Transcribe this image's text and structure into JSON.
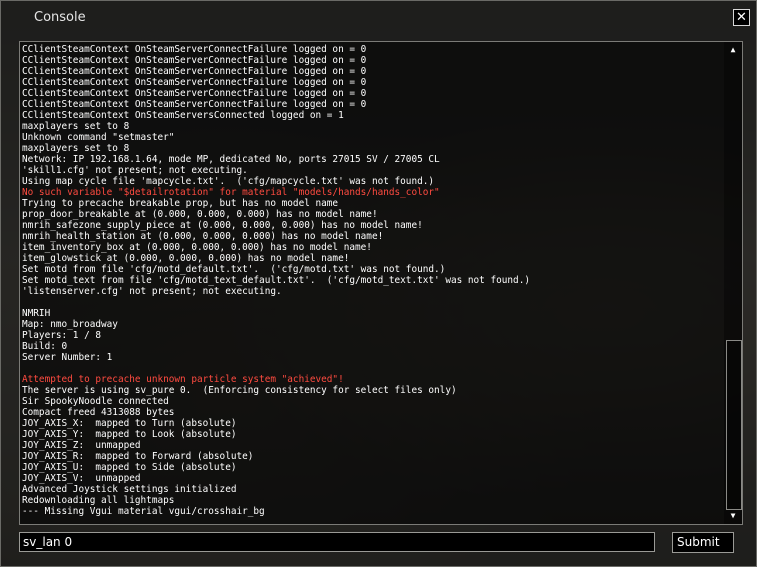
{
  "window": {
    "title": "Console",
    "close_icon": "close-icon"
  },
  "console": {
    "lines": [
      {
        "text": "CClientSteamContext OnSteamServerConnectFailure logged on = 0",
        "color": "#ffffff"
      },
      {
        "text": "CClientSteamContext OnSteamServerConnectFailure logged on = 0",
        "color": "#ffffff"
      },
      {
        "text": "CClientSteamContext OnSteamServerConnectFailure logged on = 0",
        "color": "#ffffff"
      },
      {
        "text": "CClientSteamContext OnSteamServerConnectFailure logged on = 0",
        "color": "#ffffff"
      },
      {
        "text": "CClientSteamContext OnSteamServerConnectFailure logged on = 0",
        "color": "#ffffff"
      },
      {
        "text": "CClientSteamContext OnSteamServerConnectFailure logged on = 0",
        "color": "#ffffff"
      },
      {
        "text": "CClientSteamContext OnSteamServersConnected logged on = 1",
        "color": "#ffffff"
      },
      {
        "text": "maxplayers set to 8",
        "color": "#ffffff"
      },
      {
        "text": "Unknown command \"setmaster\"",
        "color": "#ffffff"
      },
      {
        "text": "maxplayers set to 8",
        "color": "#ffffff"
      },
      {
        "text": "Network: IP 192.168.1.64, mode MP, dedicated No, ports 27015 SV / 27005 CL",
        "color": "#ffffff"
      },
      {
        "text": "'skill1.cfg' not present; not executing.",
        "color": "#ffffff"
      },
      {
        "text": "Using map cycle file 'mapcycle.txt'.  ('cfg/mapcycle.txt' was not found.)",
        "color": "#ffffff"
      },
      {
        "text": "No such variable \"$detailrotation\" for material \"models/hands/hands_color\"",
        "color": "#ff4b40"
      },
      {
        "text": "Trying to precache breakable prop, but has no model name",
        "color": "#ffffff"
      },
      {
        "text": "prop_door_breakable at (0.000, 0.000, 0.000) has no model name!",
        "color": "#ffffff"
      },
      {
        "text": "nmrih_safezone_supply_piece at (0.000, 0.000, 0.000) has no model name!",
        "color": "#ffffff"
      },
      {
        "text": "nmrih_health_station at (0.000, 0.000, 0.000) has no model name!",
        "color": "#ffffff"
      },
      {
        "text": "item_inventory_box at (0.000, 0.000, 0.000) has no model name!",
        "color": "#ffffff"
      },
      {
        "text": "item_glowstick at (0.000, 0.000, 0.000) has no model name!",
        "color": "#ffffff"
      },
      {
        "text": "Set motd from file 'cfg/motd_default.txt'.  ('cfg/motd.txt' was not found.)",
        "color": "#ffffff"
      },
      {
        "text": "Set motd_text from file 'cfg/motd_text_default.txt'.  ('cfg/motd_text.txt' was not found.)",
        "color": "#ffffff"
      },
      {
        "text": "'listenserver.cfg' not present; not executing.",
        "color": "#ffffff"
      },
      {
        "text": "",
        "color": "#ffffff"
      },
      {
        "text": "NMRIH",
        "color": "#ffffff"
      },
      {
        "text": "Map: nmo_broadway",
        "color": "#ffffff"
      },
      {
        "text": "Players: 1 / 8",
        "color": "#ffffff"
      },
      {
        "text": "Build: 0",
        "color": "#ffffff"
      },
      {
        "text": "Server Number: 1",
        "color": "#ffffff"
      },
      {
        "text": "",
        "color": "#ffffff"
      },
      {
        "text": "Attempted to precache unknown particle system \"achieved\"!",
        "color": "#ff4b40"
      },
      {
        "text": "The server is using sv_pure 0.  (Enforcing consistency for select files only)",
        "color": "#ffffff"
      },
      {
        "text": "Sir SpookyNoodle connected",
        "color": "#ffffff"
      },
      {
        "text": "Compact freed 4313088 bytes",
        "color": "#ffffff"
      },
      {
        "text": "JOY_AXIS_X:  mapped to Turn (absolute)",
        "color": "#ffffff"
      },
      {
        "text": "JOY_AXIS_Y:  mapped to Look (absolute)",
        "color": "#ffffff"
      },
      {
        "text": "JOY_AXIS_Z:  unmapped",
        "color": "#ffffff"
      },
      {
        "text": "JOY_AXIS_R:  mapped to Forward (absolute)",
        "color": "#ffffff"
      },
      {
        "text": "JOY_AXIS_U:  mapped to Side (absolute)",
        "color": "#ffffff"
      },
      {
        "text": "JOY_AXIS_V:  unmapped",
        "color": "#ffffff"
      },
      {
        "text": "Advanced Joystick settings initialized",
        "color": "#ffffff"
      },
      {
        "text": "Redownloading all lightmaps",
        "color": "#ffffff"
      },
      {
        "text": "--- Missing Vgui material vgui/crosshair_bg",
        "color": "#ffffff"
      }
    ],
    "scroll_up_icon": "scroll-up-icon",
    "scroll_down_icon": "scroll-down-icon"
  },
  "input": {
    "value": "sv_lan 0"
  },
  "submit": {
    "label": "Submit"
  }
}
